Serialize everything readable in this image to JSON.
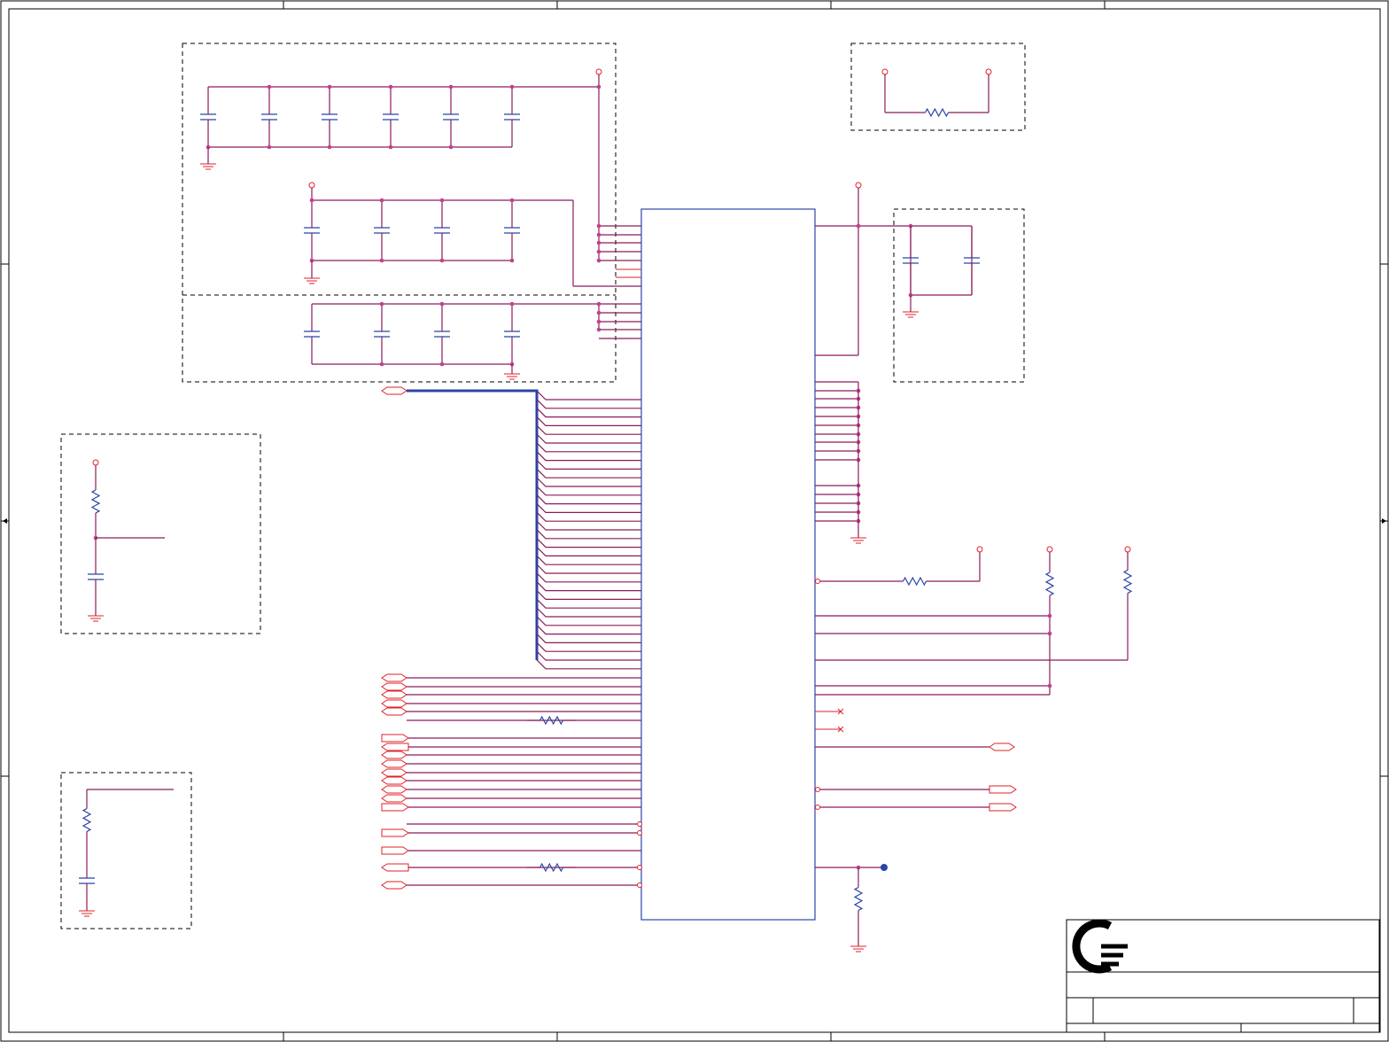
{
  "sheet": {
    "title_block": {
      "logo_icon": "company-logo-icon"
    }
  },
  "colors": {
    "wire": "#8a1c5a",
    "pin": "#e0222a",
    "component": "#2a45a8",
    "junction": "#c2408f"
  }
}
